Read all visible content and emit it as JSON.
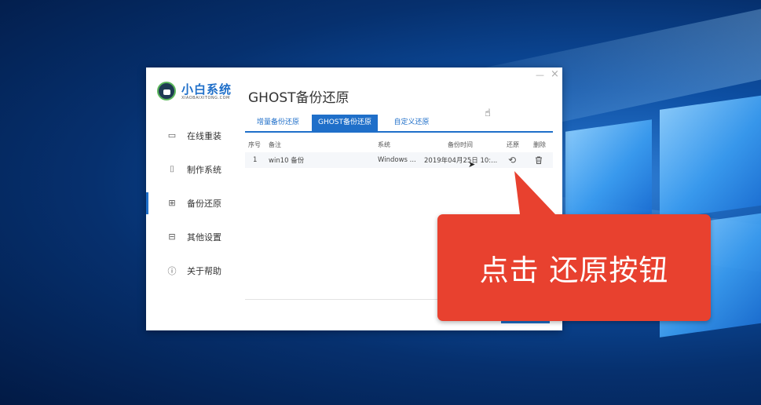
{
  "app": {
    "brand_name": "小白系统",
    "brand_sub": "XIAOBAIXITONG.COM",
    "minimize": "—",
    "close": "×",
    "page_title": "GHOST备份还原"
  },
  "sidebar": {
    "items": [
      {
        "label": "在线重装",
        "icon": "monitor-icon"
      },
      {
        "label": "制作系统",
        "icon": "usb-icon"
      },
      {
        "label": "备份还原",
        "icon": "backup-icon"
      },
      {
        "label": "其他设置",
        "icon": "toolbox-icon"
      },
      {
        "label": "关于帮助",
        "icon": "info-icon"
      }
    ]
  },
  "tabs": [
    {
      "label": "增量备份还原"
    },
    {
      "label": "GHOST备份还原"
    },
    {
      "label": "自定义还原"
    }
  ],
  "table": {
    "headers": [
      "序号",
      "备注",
      "系统",
      "备份时间",
      "还原",
      "删除"
    ],
    "rows": [
      {
        "index": "1",
        "note": "win10 备份",
        "system": "Windows ...",
        "time": "2019年04月25日 10:..."
      }
    ]
  },
  "callout": {
    "text": "点击 还原按钮"
  },
  "colors": {
    "accent": "#1f6fc9",
    "callout": "#e8412f"
  }
}
